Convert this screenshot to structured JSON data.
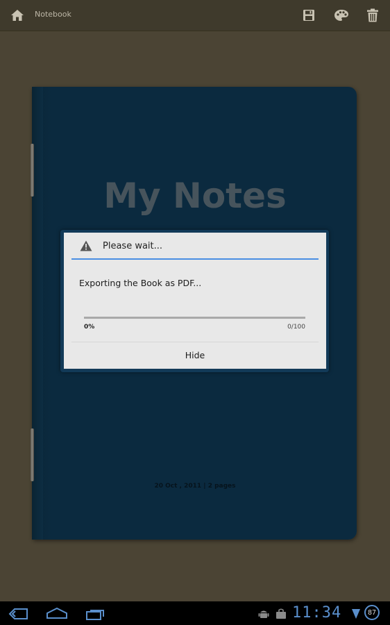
{
  "action_bar": {
    "title": "Notebook",
    "icons": [
      "home-icon",
      "save-icon",
      "palette-icon",
      "trash-icon"
    ]
  },
  "notebook": {
    "title": "My Notes",
    "date_info": "20 Oct , 2011 | 2 pages"
  },
  "dialog": {
    "title": "Please wait...",
    "message": "Exporting the Book as PDF...",
    "progress_percent": "0%",
    "progress_count": "0/100",
    "progress_fraction": 0,
    "hide_label": "Hide"
  },
  "system_bar": {
    "clock": "11:34",
    "battery": "87",
    "icons": [
      "back-icon",
      "home-nav-icon",
      "recent-apps-icon",
      "android-debug-icon",
      "bag-icon",
      "signal-icon"
    ]
  },
  "colors": {
    "accent": "#4a8ee3",
    "cover": "#0b2a3f",
    "background": "#4b4434",
    "clock": "#5a8fcc"
  }
}
